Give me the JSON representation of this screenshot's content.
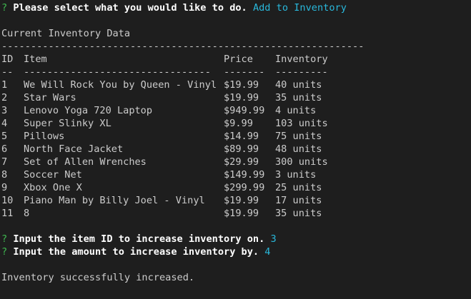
{
  "prompt_select": {
    "mark": "?",
    "question": "Please select what you would like to do.",
    "answer": "Add to Inventory"
  },
  "section_title": "Current Inventory Data",
  "divider": "--------------------------------------------------------------",
  "table": {
    "headers": {
      "id": "ID",
      "item": "Item",
      "price": "Price",
      "inventory": "Inventory"
    },
    "underlines": {
      "id": "--",
      "item": "--------------------------------",
      "price": "-------",
      "inventory": "---------"
    },
    "rows": [
      {
        "id": "1",
        "item": "We Will Rock You by Queen - Vinyl",
        "price": "$19.99",
        "inventory": "40 units"
      },
      {
        "id": "2",
        "item": "Star Wars",
        "price": "$19.99",
        "inventory": "35 units"
      },
      {
        "id": "3",
        "item": "Lenovo Yoga 720 Laptop",
        "price": "$949.99",
        "inventory": "4 units"
      },
      {
        "id": "4",
        "item": "Super Slinky XL",
        "price": "$9.99",
        "inventory": "103 units"
      },
      {
        "id": "5",
        "item": "Pillows",
        "price": "$14.99",
        "inventory": "75 units"
      },
      {
        "id": "6",
        "item": "North Face Jacket",
        "price": "$89.99",
        "inventory": "48 units"
      },
      {
        "id": "7",
        "item": "Set of Allen Wrenches",
        "price": "$29.99",
        "inventory": "300 units"
      },
      {
        "id": "8",
        "item": "Soccer Net",
        "price": "$149.99",
        "inventory": "3 units"
      },
      {
        "id": "9",
        "item": "Xbox One X",
        "price": "$299.99",
        "inventory": "25 units"
      },
      {
        "id": "10",
        "item": "Piano Man by Billy Joel - Vinyl",
        "price": "$19.99",
        "inventory": "17 units"
      },
      {
        "id": "11",
        "item": "8",
        "price": "$19.99",
        "inventory": "35 units"
      }
    ]
  },
  "prompt_item_id": {
    "mark": "?",
    "question": "Input the item ID to increase inventory on.",
    "answer": "3"
  },
  "prompt_amount": {
    "mark": "?",
    "question": "Input the amount to increase inventory by.",
    "answer": "4"
  },
  "result_message": "Inventory successfully increased.",
  "colors": {
    "background": "#1e1e1e",
    "text": "#cccccc",
    "prompt_mark": "#3fb950",
    "answer": "#29b8db"
  }
}
